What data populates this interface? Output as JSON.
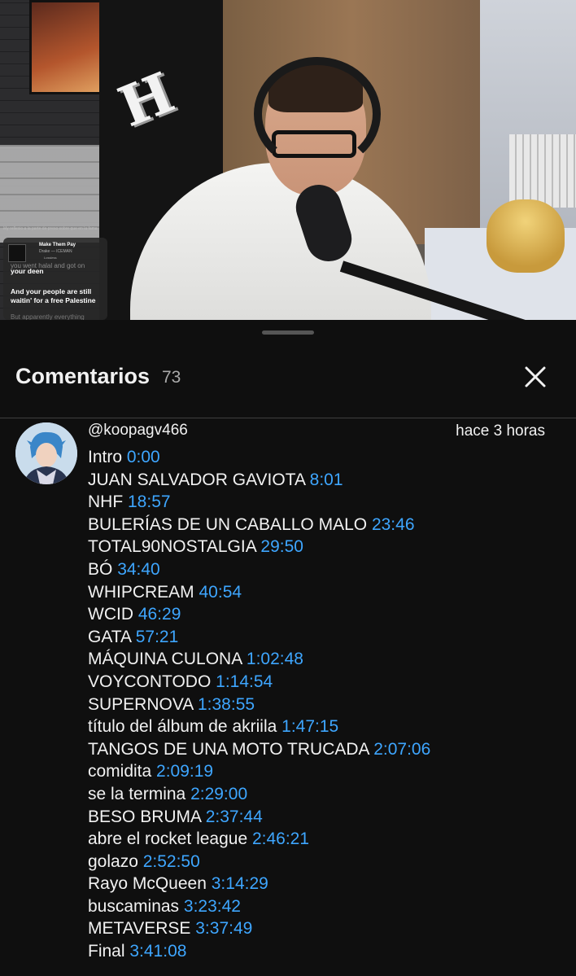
{
  "video": {
    "music_card": {
      "top_caption": "My reflexio a la parte de preso sobre que en la fama",
      "title": "Make Them Pay",
      "artist": "Drake — ICEMAN",
      "badge": "Lossless",
      "lyric_faded": "you went halal and got on",
      "lyric_1": "your deen",
      "lyric_2": "And your people are still waitin' for a free Palestine",
      "lyric_3": "But apparently everything"
    },
    "logo_letter": "H"
  },
  "sheet": {
    "title": "Comentarios",
    "count": "73"
  },
  "comment": {
    "author": "@koopagv466",
    "time": "hace 3 horas",
    "lines": [
      {
        "text": "Intro ",
        "ts": "0:00"
      },
      {
        "text": "JUAN SALVADOR GAVIOTA ",
        "ts": "8:01"
      },
      {
        "text": "NHF ",
        "ts": "18:57"
      },
      {
        "text": "BULERÍAS DE UN CABALLO MALO ",
        "ts": "23:46"
      },
      {
        "text": "TOTAL90NOSTALGIA ",
        "ts": "29:50"
      },
      {
        "text": "BÓ ",
        "ts": "34:40"
      },
      {
        "text": "WHIPCREAM ",
        "ts": "40:54"
      },
      {
        "text": "WCID ",
        "ts": "46:29"
      },
      {
        "text": "GATA ",
        "ts": "57:21"
      },
      {
        "text": "MÁQUINA CULONA ",
        "ts": "1:02:48"
      },
      {
        "text": "VOYCONTODO ",
        "ts": "1:14:54"
      },
      {
        "text": "SUPERNOVA ",
        "ts": "1:38:55"
      },
      {
        "text": "título del álbum de akriila ",
        "ts": "1:47:15"
      },
      {
        "text": "TANGOS DE UNA MOTO TRUCADA ",
        "ts": "2:07:06"
      },
      {
        "text": "comidita ",
        "ts": "2:09:19"
      },
      {
        "text": "se la termina ",
        "ts": "2:29:00"
      },
      {
        "text": "BESO BRUMA ",
        "ts": "2:37:44"
      },
      {
        "text": "abre el rocket league ",
        "ts": "2:46:21"
      },
      {
        "text": "golazo ",
        "ts": "2:52:50"
      },
      {
        "text": "Rayo McQueen ",
        "ts": "3:14:29"
      },
      {
        "text": "buscaminas ",
        "ts": "3:23:42"
      },
      {
        "text": "METAVERSE ",
        "ts": "3:37:49"
      },
      {
        "text": "Final ",
        "ts": "3:41:08"
      }
    ]
  },
  "colors": {
    "background": "#0f0f0f",
    "timestamp_link": "#3ea6ff",
    "muted_text": "#aaaaaa"
  },
  "icons": {
    "close": "close-icon",
    "drag": "drag-handle"
  }
}
